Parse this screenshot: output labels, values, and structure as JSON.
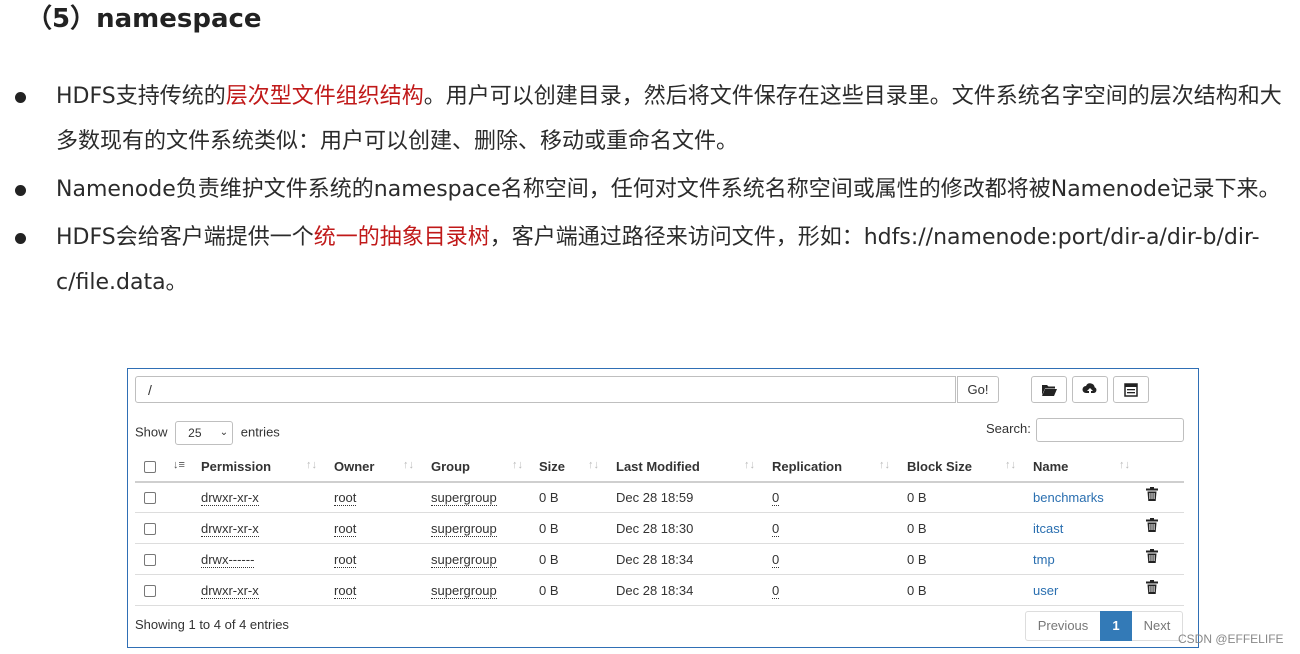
{
  "heading": "（5）namespace",
  "bullets": [
    {
      "before": "HDFS支持传统的",
      "highlight": "层次型文件组织结构",
      "after": "。用户可以创建目录，然后将文件保存在这些目录里。文件系统名字空间的层次结构和大多数现有的文件系统类似：用户可以创建、删除、移动或重命名文件。"
    },
    {
      "before": "Namenode负责维护文件系统的namespace名称空间，任何对文件系统名称空间或属性的修改都将被Namenode记录下来。",
      "highlight": "",
      "after": ""
    },
    {
      "before": "HDFS会给客户端提供一个",
      "highlight": "统一的抽象目录树",
      "after": "，客户端通过路径来访问文件，形如：hdfs://namenode:port/dir-a/dir-b/dir-c/file.data。"
    }
  ],
  "browser": {
    "path_value": "/",
    "go_label": "Go!",
    "show_label": "Show",
    "entries_select": "25",
    "entries_label": "entries",
    "search_label": "Search:",
    "search_value": "",
    "columns": [
      "Permission",
      "Owner",
      "Group",
      "Size",
      "Last Modified",
      "Replication",
      "Block Size",
      "Name"
    ],
    "rows": [
      {
        "permission": "drwxr-xr-x",
        "owner": "root",
        "group": "supergroup",
        "size": "0 B",
        "modified": "Dec 28 18:59",
        "replication": "0",
        "block_size": "0 B",
        "name": "benchmarks"
      },
      {
        "permission": "drwxr-xr-x",
        "owner": "root",
        "group": "supergroup",
        "size": "0 B",
        "modified": "Dec 28 18:30",
        "replication": "0",
        "block_size": "0 B",
        "name": "itcast"
      },
      {
        "permission": "drwx------",
        "owner": "root",
        "group": "supergroup",
        "size": "0 B",
        "modified": "Dec 28 18:34",
        "replication": "0",
        "block_size": "0 B",
        "name": "tmp"
      },
      {
        "permission": "drwxr-xr-x",
        "owner": "root",
        "group": "supergroup",
        "size": "0 B",
        "modified": "Dec 28 18:34",
        "replication": "0",
        "block_size": "0 B",
        "name": "user"
      }
    ],
    "footer_info": "Showing 1 to 4 of 4 entries",
    "pagination": {
      "previous": "Previous",
      "current": "1",
      "next": "Next"
    },
    "icons": [
      "folder-open-icon",
      "upload-icon",
      "clipboard-icon",
      "sort-icon",
      "trash-icon",
      "chevron-down-icon"
    ],
    "accent_color": "#337ab7",
    "link_color": "#2a6fb0"
  },
  "watermark": "CSDN @EFFELIFE"
}
